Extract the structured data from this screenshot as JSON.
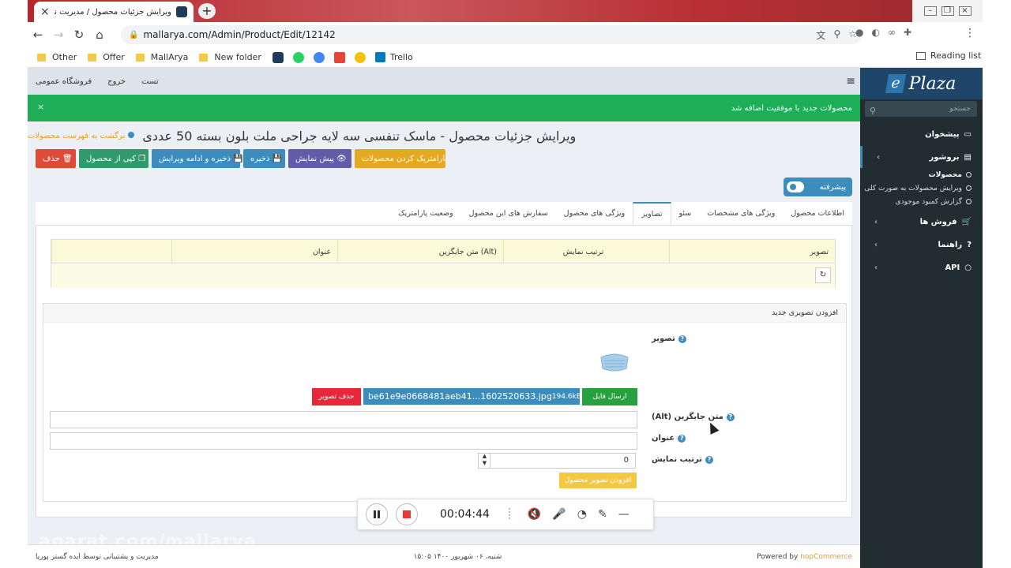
{
  "browser": {
    "tab_title": "ویرایش جزئیات محصول / مدیریت نرم افز",
    "url": "mallarya.com/Admin/Product/Edit/12142",
    "bookmarks": [
      "Other",
      "Offer",
      "MallArya",
      "New folder",
      "Trello"
    ],
    "reading_list": "Reading list"
  },
  "topnav": {
    "items": [
      "تست",
      "خروج",
      "فروشگاه عمومی"
    ]
  },
  "alert": {
    "text": "محصولات جدید با موفقیت اضافه شد"
  },
  "page": {
    "title": "ویرایش جزئیات محصول - ماسک تنفسی سه لایه جراحی ملت بلون بسته 50 عددی",
    "back_link": "برگشت به فهرست محصولات"
  },
  "actions": {
    "delete": "حذف",
    "copy": "کپی از محصول",
    "save_continue": "ذخیره و ادامه ویرایش",
    "save": "ذخیره",
    "preview": "پیش نمایش",
    "parametric": "پارامتریک کردن محصولات"
  },
  "advanced": "پیشرفته",
  "tabs": [
    "اطلاعات محصول",
    "ویژگی های مشخصات",
    "سئو",
    "تصاویر",
    "ویژگی های محصول",
    "سفارش های این محصول",
    "وضعیت پارامتریک"
  ],
  "images_table": {
    "headers": [
      "تصویر",
      "ترتیب نمایش",
      "متن جایگزین (Alt)",
      "عنوان",
      ""
    ]
  },
  "add_image": {
    "header": "افزودن تصویری جدید",
    "image_label": "تصویر",
    "file_name": "be61e9e0668481aeb41...1602520633.jpg",
    "file_size": "194.6kB",
    "send_file": "ارسال فایل",
    "delete_image": "حذف تصویر",
    "alt_label": "متن جایگزین (Alt)",
    "title_label": "عنوان",
    "order_label": "ترتیب نمایش",
    "order_value": "0",
    "add_button": "افزودن تصویر محصول"
  },
  "footer": {
    "powered_by": "Powered by",
    "nop": "nopCommerce",
    "date": "شنبه، ۰۶ شهریور ۱۴۰۰ ۱۵:۰۵",
    "support": "مدیریت و پشتیبانی توسط ایده گستر پوریا"
  },
  "watermark": "aparat.com/mallarya",
  "sidebar": {
    "logo": "Plaza",
    "logo_letter": "e",
    "search_placeholder": "جستجو",
    "dashboard": "پیشخوان",
    "catalog": "بروشور",
    "sub_items": [
      "محصولات",
      "ویرایش محصولات به صورت کلی",
      "گزارش کمبود موجودی"
    ],
    "sales": "فروش ها",
    "help": "راهنما",
    "api": "API"
  },
  "recorder": {
    "time": "00:04:44"
  }
}
